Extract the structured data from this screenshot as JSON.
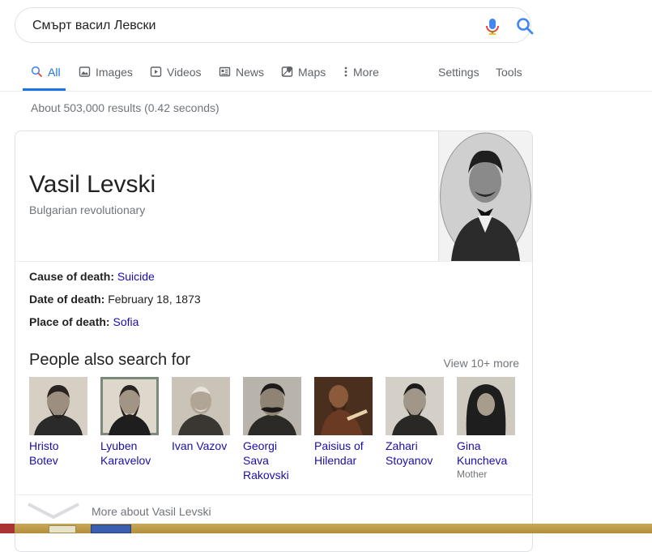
{
  "search": {
    "query": "Смърт васил Левски"
  },
  "tabs": [
    {
      "label": "All",
      "icon": "search-icon",
      "active": true
    },
    {
      "label": "Images",
      "icon": "image-icon"
    },
    {
      "label": "Videos",
      "icon": "video-icon"
    },
    {
      "label": "News",
      "icon": "news-icon"
    },
    {
      "label": "Maps",
      "icon": "map-icon"
    },
    {
      "label": "More",
      "icon": "more-vert-icon"
    }
  ],
  "tools": {
    "settings": "Settings",
    "tools": "Tools"
  },
  "stats": "About 503,000 results (0.42 seconds)",
  "knowledge_panel": {
    "name": "Vasil Levski",
    "description": "Bulgarian revolutionary",
    "facts": [
      {
        "label": "Cause of death:",
        "value": "Suicide",
        "link": true
      },
      {
        "label": "Date of death:",
        "value": "February 18, 1873",
        "link": false
      },
      {
        "label": "Place of death:",
        "value": "Sofia",
        "link": true
      }
    ],
    "people_heading": "People also search for",
    "view_more": "View 10+ more",
    "people": [
      {
        "name": "Hristo Botev",
        "sub": ""
      },
      {
        "name": "Lyuben Karavelov",
        "sub": ""
      },
      {
        "name": "Ivan Vazov",
        "sub": ""
      },
      {
        "name": "Georgi Sava Rakovski",
        "sub": ""
      },
      {
        "name": "Paisius of Hilendar",
        "sub": ""
      },
      {
        "name": "Zahari Stoyanov",
        "sub": ""
      },
      {
        "name": "Gina Kuncheva",
        "sub": "Mother"
      }
    ],
    "more_about": "More about Vasil Levski"
  },
  "colors": {
    "link": "#1a0dab",
    "accent": "#1a73e8",
    "muted": "#70757a"
  }
}
